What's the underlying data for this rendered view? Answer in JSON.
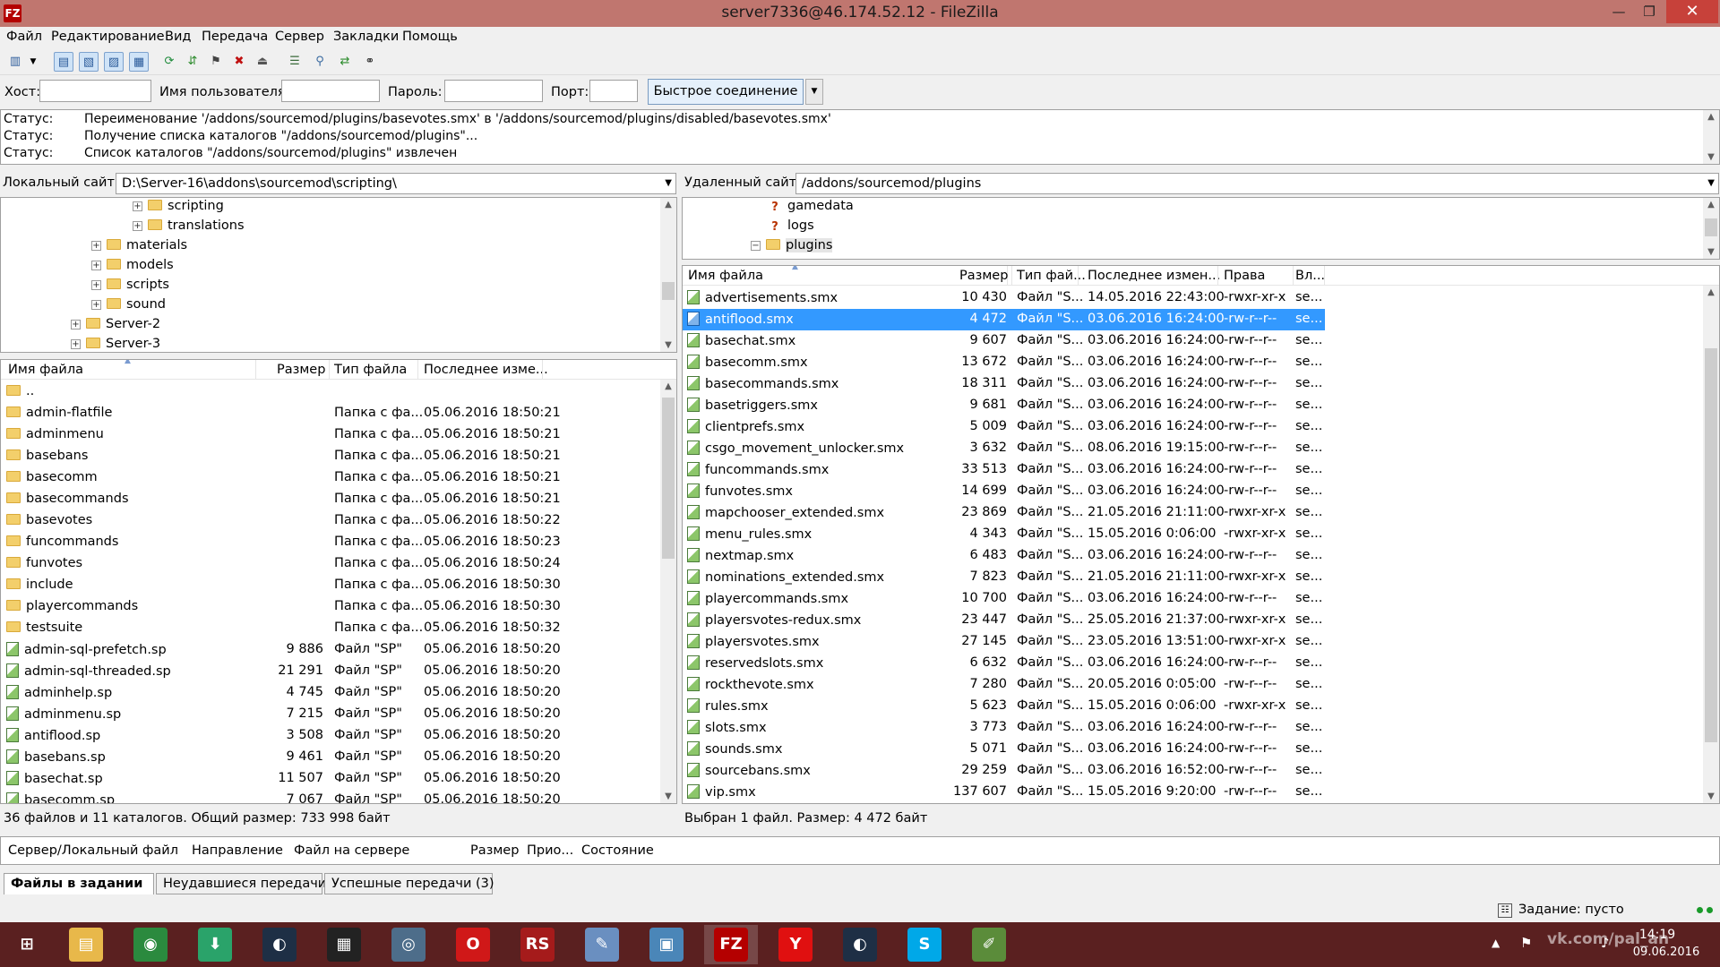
{
  "window": {
    "title": "server7336@46.174.52.12 - FileZilla",
    "app_icon": "FZ"
  },
  "menu": [
    "Файл",
    "Редактирование",
    "Вид",
    "Передача",
    "Сервер",
    "Закладки",
    "Помощь"
  ],
  "quickconnect": {
    "host_label": "Хост:",
    "user_label": "Имя пользователя",
    "pass_label": "Пароль:",
    "port_label": "Порт:",
    "button": "Быстрое соединение"
  },
  "log": [
    {
      "label": "Статус:",
      "text": "Переименование '/addons/sourcemod/plugins/basevotes.smx' в '/addons/sourcemod/plugins/disabled/basevotes.smx'"
    },
    {
      "label": "Статус:",
      "text": "Получение списка каталогов \"/addons/sourcemod/plugins\"..."
    },
    {
      "label": "Статус:",
      "text": "Список каталогов \"/addons/sourcemod/plugins\" извлечен"
    }
  ],
  "local": {
    "site_label": "Локальный сайт:",
    "path": "D:\\Server-16\\addons\\sourcemod\\scripting\\",
    "tree": [
      {
        "name": "scripting",
        "level": 3
      },
      {
        "name": "translations",
        "level": 3
      },
      {
        "name": "materials",
        "level": 2
      },
      {
        "name": "models",
        "level": 2
      },
      {
        "name": "scripts",
        "level": 2
      },
      {
        "name": "sound",
        "level": 2
      },
      {
        "name": "Server-2",
        "level": 1
      },
      {
        "name": "Server-3",
        "level": 1
      }
    ],
    "columns": [
      "Имя файла",
      "Размер",
      "Тип файла",
      "Последнее изме..."
    ],
    "files": [
      {
        "name": "..",
        "size": "",
        "type": "",
        "date": "",
        "kind": "folder"
      },
      {
        "name": "admin-flatfile",
        "size": "",
        "type": "Папка с фа...",
        "date": "05.06.2016 18:50:21",
        "kind": "folder"
      },
      {
        "name": "adminmenu",
        "size": "",
        "type": "Папка с фа...",
        "date": "05.06.2016 18:50:21",
        "kind": "folder"
      },
      {
        "name": "basebans",
        "size": "",
        "type": "Папка с фа...",
        "date": "05.06.2016 18:50:21",
        "kind": "folder"
      },
      {
        "name": "basecomm",
        "size": "",
        "type": "Папка с фа...",
        "date": "05.06.2016 18:50:21",
        "kind": "folder"
      },
      {
        "name": "basecommands",
        "size": "",
        "type": "Папка с фа...",
        "date": "05.06.2016 18:50:21",
        "kind": "folder"
      },
      {
        "name": "basevotes",
        "size": "",
        "type": "Папка с фа...",
        "date": "05.06.2016 18:50:22",
        "kind": "folder"
      },
      {
        "name": "funcommands",
        "size": "",
        "type": "Папка с фа...",
        "date": "05.06.2016 18:50:23",
        "kind": "folder"
      },
      {
        "name": "funvotes",
        "size": "",
        "type": "Папка с фа...",
        "date": "05.06.2016 18:50:24",
        "kind": "folder"
      },
      {
        "name": "include",
        "size": "",
        "type": "Папка с фа...",
        "date": "05.06.2016 18:50:30",
        "kind": "folder"
      },
      {
        "name": "playercommands",
        "size": "",
        "type": "Папка с фа...",
        "date": "05.06.2016 18:50:30",
        "kind": "folder"
      },
      {
        "name": "testsuite",
        "size": "",
        "type": "Папка с фа...",
        "date": "05.06.2016 18:50:32",
        "kind": "folder"
      },
      {
        "name": "admin-sql-prefetch.sp",
        "size": "9 886",
        "type": "Файл \"SP\"",
        "date": "05.06.2016 18:50:20",
        "kind": "file"
      },
      {
        "name": "admin-sql-threaded.sp",
        "size": "21 291",
        "type": "Файл \"SP\"",
        "date": "05.06.2016 18:50:20",
        "kind": "file"
      },
      {
        "name": "adminhelp.sp",
        "size": "4 745",
        "type": "Файл \"SP\"",
        "date": "05.06.2016 18:50:20",
        "kind": "file"
      },
      {
        "name": "adminmenu.sp",
        "size": "7 215",
        "type": "Файл \"SP\"",
        "date": "05.06.2016 18:50:20",
        "kind": "file"
      },
      {
        "name": "antiflood.sp",
        "size": "3 508",
        "type": "Файл \"SP\"",
        "date": "05.06.2016 18:50:20",
        "kind": "file"
      },
      {
        "name": "basebans.sp",
        "size": "9 461",
        "type": "Файл \"SP\"",
        "date": "05.06.2016 18:50:20",
        "kind": "file"
      },
      {
        "name": "basechat.sp",
        "size": "11 507",
        "type": "Файл \"SP\"",
        "date": "05.06.2016 18:50:20",
        "kind": "file"
      },
      {
        "name": "basecomm.sp",
        "size": "7 067",
        "type": "Файл \"SP\"",
        "date": "05.06.2016 18:50:20",
        "kind": "file"
      }
    ],
    "status": "36 файлов и 11 каталогов. Общий размер: 733 998 байт"
  },
  "remote": {
    "site_label": "Удаленный сайт:",
    "path": "/addons/sourcemod/plugins",
    "tree": [
      {
        "name": "gamedata",
        "kind": "unknown"
      },
      {
        "name": "logs",
        "kind": "unknown"
      },
      {
        "name": "plugins",
        "kind": "folder"
      }
    ],
    "columns": [
      "Имя файла",
      "Размер",
      "Тип фай...",
      "Последнее измен...",
      "Права",
      "Вл..."
    ],
    "files": [
      {
        "name": "advertisements.smx",
        "size": "10 430",
        "type": "Файл \"S...",
        "date": "14.05.2016 22:43:00",
        "perm": "-rwxr-xr-x",
        "owner": "se..."
      },
      {
        "name": "antiflood.smx",
        "size": "4 472",
        "type": "Файл \"S...",
        "date": "03.06.2016 16:24:00",
        "perm": "-rw-r--r--",
        "owner": "se...",
        "selected": true
      },
      {
        "name": "basechat.smx",
        "size": "9 607",
        "type": "Файл \"S...",
        "date": "03.06.2016 16:24:00",
        "perm": "-rw-r--r--",
        "owner": "se..."
      },
      {
        "name": "basecomm.smx",
        "size": "13 672",
        "type": "Файл \"S...",
        "date": "03.06.2016 16:24:00",
        "perm": "-rw-r--r--",
        "owner": "se..."
      },
      {
        "name": "basecommands.smx",
        "size": "18 311",
        "type": "Файл \"S...",
        "date": "03.06.2016 16:24:00",
        "perm": "-rw-r--r--",
        "owner": "se..."
      },
      {
        "name": "basetriggers.smx",
        "size": "9 681",
        "type": "Файл \"S...",
        "date": "03.06.2016 16:24:00",
        "perm": "-rw-r--r--",
        "owner": "se..."
      },
      {
        "name": "clientprefs.smx",
        "size": "5 009",
        "type": "Файл \"S...",
        "date": "03.06.2016 16:24:00",
        "perm": "-rw-r--r--",
        "owner": "se..."
      },
      {
        "name": "csgo_movement_unlocker.smx",
        "size": "3 632",
        "type": "Файл \"S...",
        "date": "08.06.2016 19:15:00",
        "perm": "-rw-r--r--",
        "owner": "se..."
      },
      {
        "name": "funcommands.smx",
        "size": "33 513",
        "type": "Файл \"S...",
        "date": "03.06.2016 16:24:00",
        "perm": "-rw-r--r--",
        "owner": "se..."
      },
      {
        "name": "funvotes.smx",
        "size": "14 699",
        "type": "Файл \"S...",
        "date": "03.06.2016 16:24:00",
        "perm": "-rw-r--r--",
        "owner": "se..."
      },
      {
        "name": "mapchooser_extended.smx",
        "size": "23 869",
        "type": "Файл \"S...",
        "date": "21.05.2016 21:11:00",
        "perm": "-rwxr-xr-x",
        "owner": "se..."
      },
      {
        "name": "menu_rules.smx",
        "size": "4 343",
        "type": "Файл \"S...",
        "date": "15.05.2016 0:06:00",
        "perm": "-rwxr-xr-x",
        "owner": "se..."
      },
      {
        "name": "nextmap.smx",
        "size": "6 483",
        "type": "Файл \"S...",
        "date": "03.06.2016 16:24:00",
        "perm": "-rw-r--r--",
        "owner": "se..."
      },
      {
        "name": "nominations_extended.smx",
        "size": "7 823",
        "type": "Файл \"S...",
        "date": "21.05.2016 21:11:00",
        "perm": "-rwxr-xr-x",
        "owner": "se..."
      },
      {
        "name": "playercommands.smx",
        "size": "10 700",
        "type": "Файл \"S...",
        "date": "03.06.2016 16:24:00",
        "perm": "-rw-r--r--",
        "owner": "se..."
      },
      {
        "name": "playersvotes-redux.smx",
        "size": "23 447",
        "type": "Файл \"S...",
        "date": "25.05.2016 21:37:00",
        "perm": "-rwxr-xr-x",
        "owner": "se..."
      },
      {
        "name": "playersvotes.smx",
        "size": "27 145",
        "type": "Файл \"S...",
        "date": "23.05.2016 13:51:00",
        "perm": "-rwxr-xr-x",
        "owner": "se..."
      },
      {
        "name": "reservedslots.smx",
        "size": "6 632",
        "type": "Файл \"S...",
        "date": "03.06.2016 16:24:00",
        "perm": "-rw-r--r--",
        "owner": "se..."
      },
      {
        "name": "rockthevote.smx",
        "size": "7 280",
        "type": "Файл \"S...",
        "date": "20.05.2016 0:05:00",
        "perm": "-rw-r--r--",
        "owner": "se..."
      },
      {
        "name": "rules.smx",
        "size": "5 623",
        "type": "Файл \"S...",
        "date": "15.05.2016 0:06:00",
        "perm": "-rwxr-xr-x",
        "owner": "se..."
      },
      {
        "name": "slots.smx",
        "size": "3 773",
        "type": "Файл \"S...",
        "date": "03.06.2016 16:24:00",
        "perm": "-rw-r--r--",
        "owner": "se..."
      },
      {
        "name": "sounds.smx",
        "size": "5 071",
        "type": "Файл \"S...",
        "date": "03.06.2016 16:24:00",
        "perm": "-rw-r--r--",
        "owner": "se..."
      },
      {
        "name": "sourcebans.smx",
        "size": "29 259",
        "type": "Файл \"S...",
        "date": "03.06.2016 16:52:00",
        "perm": "-rw-r--r--",
        "owner": "se..."
      },
      {
        "name": "vip.smx",
        "size": "137 607",
        "type": "Файл \"S...",
        "date": "15.05.2016 9:20:00",
        "perm": "-rw-r--r--",
        "owner": "se..."
      }
    ],
    "status": "Выбран 1 файл. Размер: 4 472 байт"
  },
  "queue": {
    "columns": [
      "Сервер/Локальный файл",
      "Направление",
      "Файл на сервере",
      "Размер",
      "Прио...",
      "Состояние"
    ],
    "tabs": [
      "Файлы в задании",
      "Неудавшиеся передачи",
      "Успешные передачи (3)"
    ],
    "status": "Задание: пусто"
  },
  "taskbar": {
    "apps": [
      {
        "name": "start-button",
        "glyph": "⊞",
        "color": "#5a2020"
      },
      {
        "name": "explorer",
        "glyph": "▤",
        "color": "#e8b84a"
      },
      {
        "name": "chrome",
        "glyph": "◉",
        "color": "#2b8a3e"
      },
      {
        "name": "downloader",
        "glyph": "⬇",
        "color": "#2aa36a"
      },
      {
        "name": "steam",
        "glyph": "◐",
        "color": "#1e2f45"
      },
      {
        "name": "video-editor",
        "glyph": "▦",
        "color": "#222222"
      },
      {
        "name": "aida",
        "glyph": "◎",
        "color": "#4d6d8a"
      },
      {
        "name": "opera",
        "glyph": "O",
        "color": "#d01818"
      },
      {
        "name": "rs",
        "glyph": "RS",
        "color": "#a51b1b"
      },
      {
        "name": "paint",
        "glyph": "✎",
        "color": "#6a8fc0"
      },
      {
        "name": "network",
        "glyph": "▣",
        "color": "#4a86b8"
      },
      {
        "name": "filezilla",
        "glyph": "FZ",
        "color": "#b40000"
      },
      {
        "name": "yandex",
        "glyph": "Y",
        "color": "#e01010"
      },
      {
        "name": "steam2",
        "glyph": "◐",
        "color": "#1e2f45"
      },
      {
        "name": "skype",
        "glyph": "S",
        "color": "#00a8e8"
      },
      {
        "name": "notepad",
        "glyph": "✐",
        "color": "#5b8c3a"
      }
    ],
    "time": "14:19",
    "date": "09.06.2016",
    "watermark": "vk.com/pal_an"
  }
}
